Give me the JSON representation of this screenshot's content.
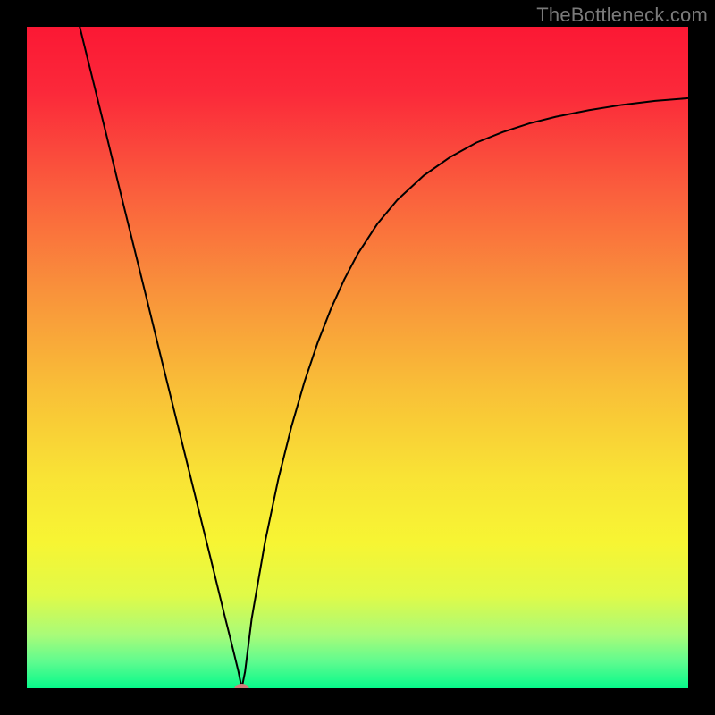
{
  "watermark": "TheBottleneck.com",
  "chart_data": {
    "type": "line",
    "title": "",
    "xlabel": "",
    "ylabel": "",
    "xlim": [
      0,
      100
    ],
    "ylim": [
      0,
      100
    ],
    "grid": false,
    "legend": false,
    "background_gradient": {
      "stops": [
        {
          "offset": 0.0,
          "color": "#fb1834"
        },
        {
          "offset": 0.1,
          "color": "#fb293a"
        },
        {
          "offset": 0.25,
          "color": "#fa5f3d"
        },
        {
          "offset": 0.4,
          "color": "#f9923b"
        },
        {
          "offset": 0.55,
          "color": "#f9c037"
        },
        {
          "offset": 0.68,
          "color": "#f9e335"
        },
        {
          "offset": 0.78,
          "color": "#f7f533"
        },
        {
          "offset": 0.86,
          "color": "#e0fa48"
        },
        {
          "offset": 0.92,
          "color": "#a8fb79"
        },
        {
          "offset": 0.96,
          "color": "#5ffb8f"
        },
        {
          "offset": 1.0,
          "color": "#06f98a"
        }
      ]
    },
    "marker": {
      "x": 32.5,
      "y": 0,
      "color": "#d17b7a",
      "rx": 8,
      "ry": 5
    },
    "series": [
      {
        "name": "curve",
        "color": "#000000",
        "width": 2,
        "x": [
          8,
          10,
          12,
          14,
          16,
          18,
          20,
          22,
          24,
          26,
          28,
          30,
          31,
          32,
          32.5,
          33,
          34,
          36,
          38,
          40,
          42,
          44,
          46,
          48,
          50,
          53,
          56,
          60,
          64,
          68,
          72,
          76,
          80,
          85,
          90,
          95,
          100
        ],
        "y": [
          100,
          91.9,
          83.8,
          75.6,
          67.5,
          59.4,
          51.2,
          43.1,
          35.0,
          26.9,
          18.8,
          10.6,
          6.6,
          2.5,
          0,
          2.5,
          10.5,
          22.0,
          31.5,
          39.5,
          46.4,
          52.3,
          57.4,
          61.8,
          65.6,
          70.2,
          73.8,
          77.5,
          80.3,
          82.5,
          84.1,
          85.4,
          86.4,
          87.4,
          88.2,
          88.8,
          89.2
        ]
      }
    ]
  }
}
